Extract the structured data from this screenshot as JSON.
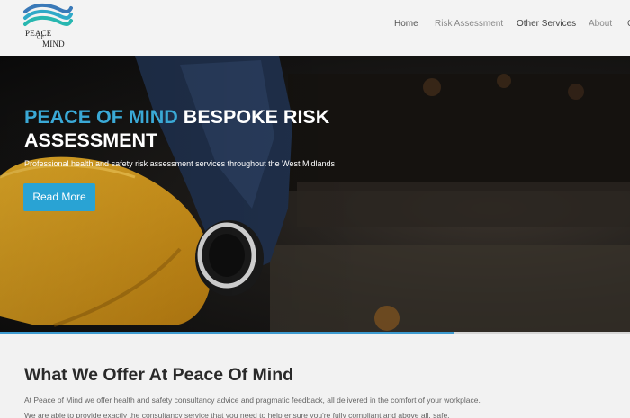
{
  "header": {
    "logo": {
      "line1": "PEACE",
      "line2": "OF",
      "line3": "MIND",
      "icon": "waves-icon"
    },
    "nav": [
      "Home",
      "Risk Assessment",
      "Other Services",
      "About",
      "C"
    ]
  },
  "hero": {
    "title_accent": "PEACE OF MIND",
    "title_rest": " BESPOKE RISK ASSESSMENT",
    "subtitle": "Professional health and safety risk assessment services throughout the West Midlands",
    "button_label": "Read More",
    "slide_progress": 0.72
  },
  "content": {
    "heading": "What We Offer At Peace Of Mind",
    "paragraph_1": "At Peace of Mind we offer health and safety consultancy advice and pragmatic feedback, all delivered in the comfort of your workplace.",
    "paragraph_2": "We are able to provide exactly the consultancy service that you need to help ensure you're fully compliant and above all, safe."
  },
  "colors": {
    "accent": "#3aa9d6",
    "button": "#29a3d4",
    "helmet": "#e0a51e",
    "progress": "#3e9bd0"
  }
}
